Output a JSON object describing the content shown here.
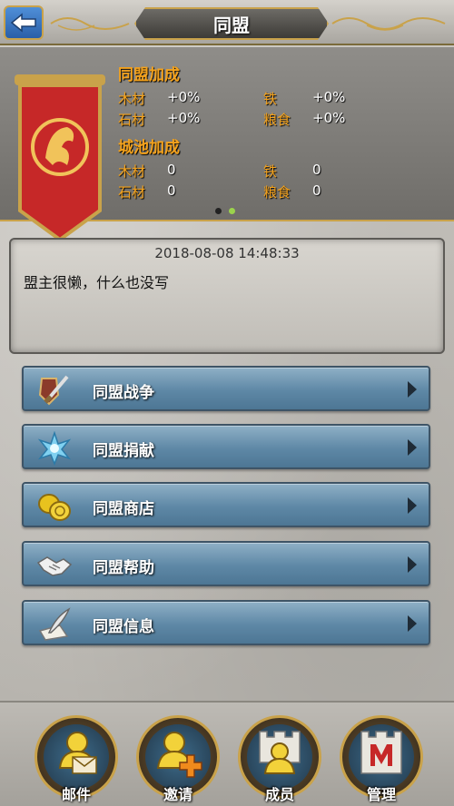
{
  "header": {
    "title": "同盟"
  },
  "alliance_bonus": {
    "title": "同盟加成",
    "stats": [
      {
        "label": "木材",
        "value": "+0%"
      },
      {
        "label": "石材",
        "value": "+0%"
      },
      {
        "label": "铁",
        "value": "+0%"
      },
      {
        "label": "粮食",
        "value": "+0%"
      }
    ]
  },
  "city_bonus": {
    "title": "城池加成",
    "stats": [
      {
        "label": "木材",
        "value": "0"
      },
      {
        "label": "石材",
        "value": "0"
      },
      {
        "label": "铁",
        "value": "0"
      },
      {
        "label": "粮食",
        "value": "0"
      }
    ]
  },
  "pager": {
    "active_index": 0,
    "count": 2
  },
  "notice": {
    "timestamp": "2018-08-08 14:48:33",
    "text": "盟主很懒，什么也没写"
  },
  "menu": [
    {
      "label": "同盟战争",
      "icon": "war-icon"
    },
    {
      "label": "同盟捐献",
      "icon": "donate-icon"
    },
    {
      "label": "同盟商店",
      "icon": "shop-icon"
    },
    {
      "label": "同盟帮助",
      "icon": "help-icon"
    },
    {
      "label": "同盟信息",
      "icon": "info-icon"
    }
  ],
  "bottom_nav": [
    {
      "label": "邮件",
      "icon": "mail-icon"
    },
    {
      "label": "邀请",
      "icon": "invite-icon"
    },
    {
      "label": "成员",
      "icon": "members-icon"
    },
    {
      "label": "管理",
      "icon": "manage-icon"
    }
  ],
  "colors": {
    "accent_gold": "#c9a24a",
    "label_orange": "#f4a21c",
    "menu_blue": "#5e88a6",
    "banner_red": "#c62828"
  }
}
